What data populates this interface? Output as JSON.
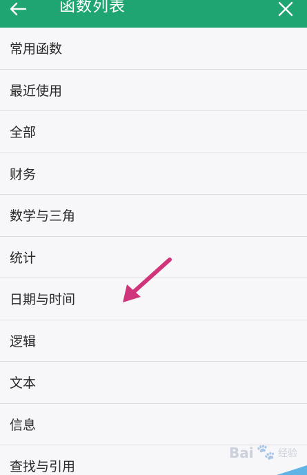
{
  "header": {
    "title": "函数列表",
    "back_icon": "arrow-left-icon",
    "close_icon": "close-icon",
    "bg_color": "#1fa571"
  },
  "list": {
    "items": [
      {
        "label": "常用函数"
      },
      {
        "label": "最近使用"
      },
      {
        "label": "全部"
      },
      {
        "label": "财务"
      },
      {
        "label": "数学与三角"
      },
      {
        "label": "统计"
      },
      {
        "label": "日期与时间"
      },
      {
        "label": "逻辑"
      },
      {
        "label": "文本"
      },
      {
        "label": "信息"
      },
      {
        "label": "查找与引用"
      }
    ]
  },
  "annotation": {
    "arrow_color": "#d0357b",
    "arrow_icon": "pointer-arrow-icon"
  },
  "watermark": {
    "text": "Bai",
    "paw": "🐾",
    "sub": "经验"
  }
}
